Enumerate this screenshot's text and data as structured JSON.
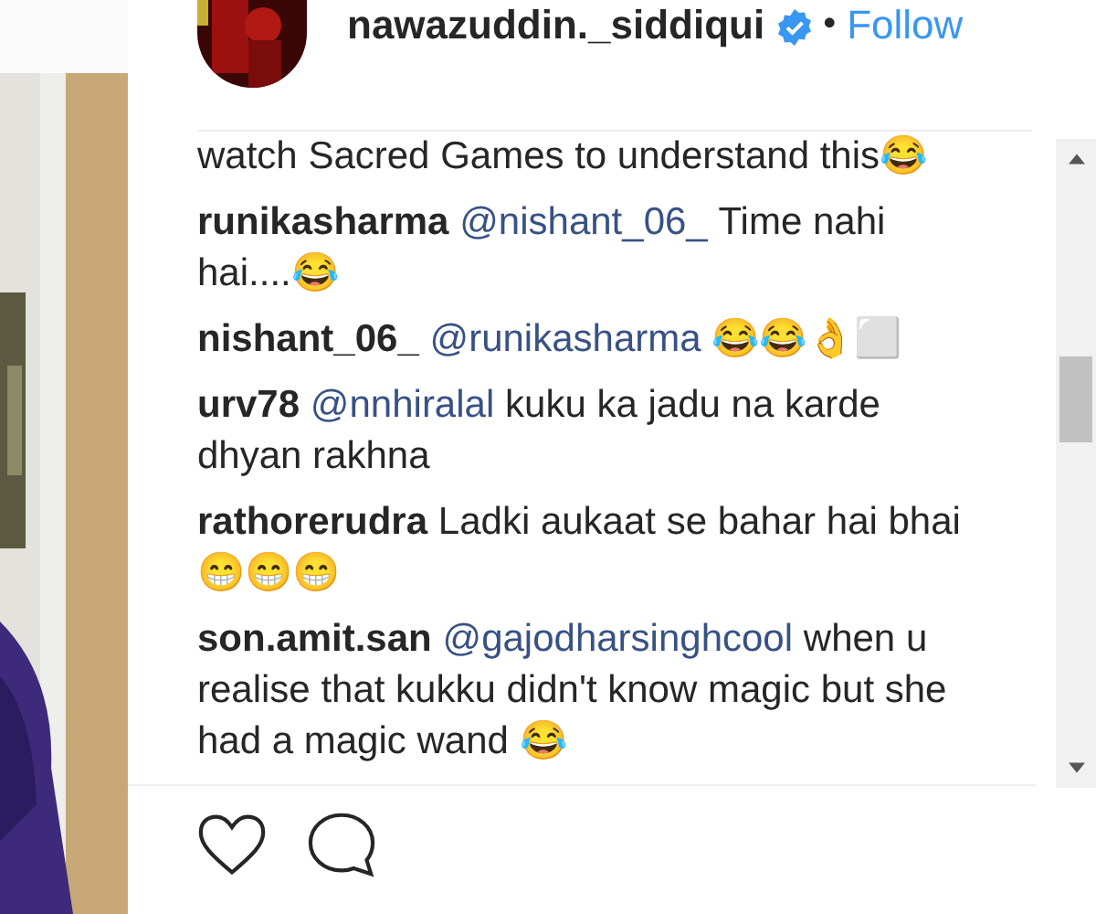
{
  "header": {
    "username": "nawazuddin._siddiqui",
    "separator": "•",
    "follow": "Follow"
  },
  "comments": [
    {
      "text": "watch Sacred Games to understand this😂"
    },
    {
      "user": "runikasharma",
      "mention": "@nishant_06_",
      "text": "Time nahi hai....😂"
    },
    {
      "user": "nishant_06_",
      "mention": "@runikasharma",
      "text": "😂😂👌⬜"
    },
    {
      "user": "urv78",
      "mention": "@nnhiralal",
      "text": "kuku ka jadu na karde dhyan rakhna"
    },
    {
      "user": "rathorerudra",
      "text": "Ladki aukaat se bahar hai bhai😁😁😁"
    },
    {
      "user": "son.amit.san",
      "mention": "@gajodharsinghcool",
      "text": "when u realise that kukku didn't know magic but she had a magic wand 😂"
    }
  ]
}
